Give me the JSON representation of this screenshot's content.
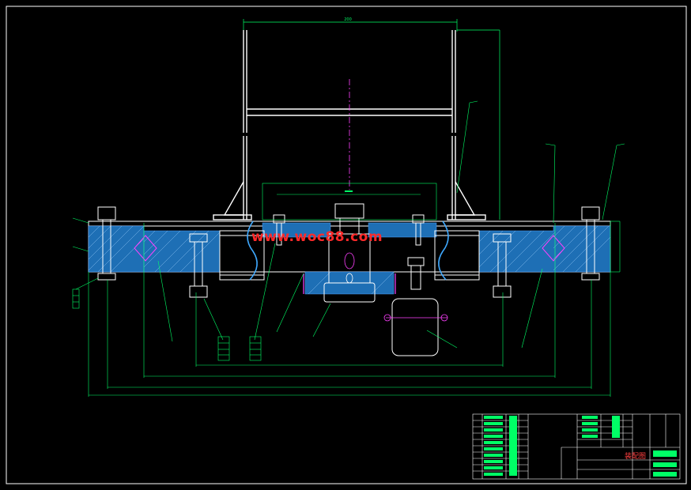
{
  "drawing": {
    "watermark": "www.woc88.com",
    "dimensions": {
      "top_width": "200"
    },
    "title_block": {
      "name_label": "装配图"
    }
  }
}
